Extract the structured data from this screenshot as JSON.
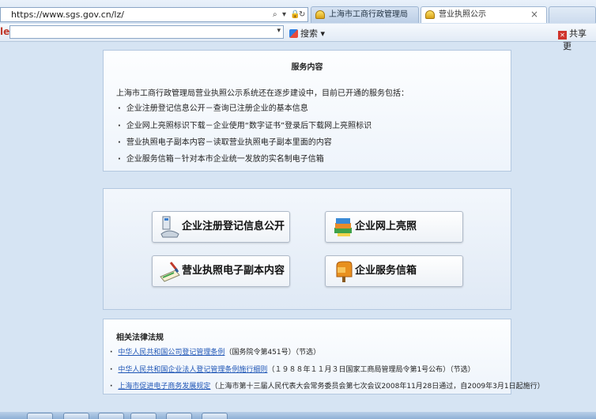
{
  "browser": {
    "url": "https://www.sgs.gov.cn/lz/",
    "tabs": [
      {
        "label": "上海市工商行政管理局",
        "active": false
      },
      {
        "label": "营业执照公示",
        "active": true
      }
    ],
    "tab_close": "×",
    "search_logo_fragment": "le",
    "search_button": "搜索",
    "search_dropdown": "▾",
    "share_label": "共享",
    "overflow_label": "更"
  },
  "services": {
    "title": "服务内容",
    "intro": "上海市工商行政管理局营业执照公示系统还在逐步建设中，目前已开通的服务包括：",
    "items": [
      "企业注册登记信息公开－查询已注册企业的基本信息",
      "企业网上亮照标识下载－企业使用“数字证书”登录后下载网上亮照标识",
      "营业执照电子副本内容－读取营业执照电子副本里面的内容",
      "企业服务信箱－针对本市企业统一发放的实名制电子信箱"
    ]
  },
  "buttons": [
    {
      "label": "企业注册登记信息公开",
      "icon": "computer-icon"
    },
    {
      "label": "企业网上亮照",
      "icon": "books-icon"
    },
    {
      "label": "营业执照电子副本内容",
      "icon": "certificate-pen-icon"
    },
    {
      "label": "企业服务信箱",
      "icon": "mailbox-icon"
    }
  ],
  "laws": {
    "title": "相关法律法规",
    "items": [
      {
        "link": "中华人民共和国公司登记管理条例",
        "note": "（国务院令第451号）（节选）"
      },
      {
        "link": "中华人民共和国企业法人登记管理条例施行细则",
        "note": "（１９８８年１１月３日国家工商局管理局令第1号公布）（节选）"
      },
      {
        "link": "上海市促进电子商务发展规定",
        "note": "（上海市第十三届人民代表大会常务委员会第七次会议2008年11月28日通过，自2009年3月1日起施行）"
      }
    ]
  },
  "colors": {
    "link": "#1f56b6",
    "page_background": "#d6e4f3",
    "panel_border": "#b3c8e0"
  }
}
